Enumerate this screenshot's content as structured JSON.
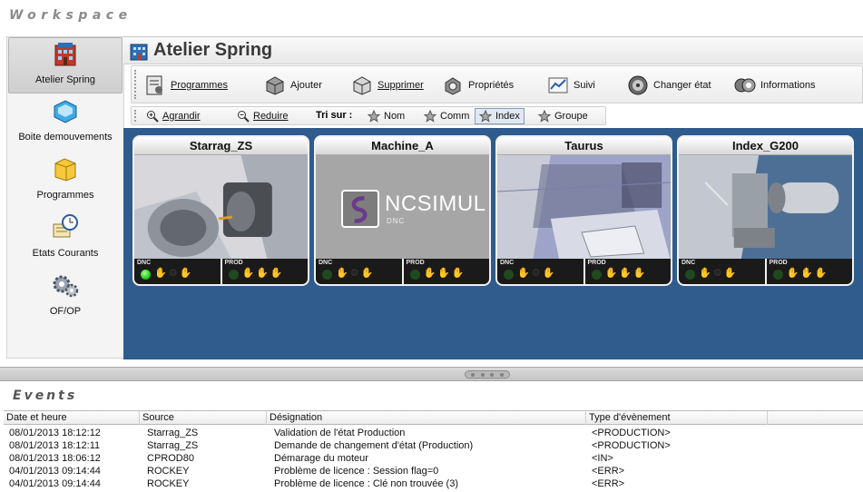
{
  "workspace_title": "Workspace",
  "sidebar": {
    "items": [
      {
        "label": "Atelier Spring",
        "icon": "building-icon",
        "active": true
      },
      {
        "label": "Boite demouvements",
        "icon": "tray-icon",
        "active": false
      },
      {
        "label": "Programmes",
        "icon": "folder-icon",
        "active": false
      },
      {
        "label": "Etats Courants",
        "icon": "clock-icon",
        "active": false
      },
      {
        "label": "OF/OP",
        "icon": "gears-icon",
        "active": false
      }
    ]
  },
  "main": {
    "title": "Atelier Spring",
    "toolbar": [
      {
        "label": "Programmes",
        "icon": "programs-icon",
        "underline": true
      },
      {
        "label": "Ajouter",
        "icon": "add-icon",
        "underline": false
      },
      {
        "label": "Supprimer",
        "icon": "delete-icon",
        "underline": true
      },
      {
        "label": "Propriétés",
        "icon": "properties-icon",
        "underline": false
      },
      {
        "label": "Suivi",
        "icon": "chart-icon",
        "underline": false
      },
      {
        "label": "Changer état",
        "icon": "change-state-icon",
        "underline": false
      },
      {
        "label": "Informations",
        "icon": "info-icon",
        "underline": false
      }
    ],
    "toolbar2": {
      "agrandir": "Agrandir",
      "reduire": "Reduire",
      "tri_sur": "Tri sur :",
      "sort_options": [
        "Nom",
        "Comm",
        "Index",
        "Groupe"
      ],
      "selected_sort": "Index"
    },
    "machines": [
      {
        "name": "Starrag_ZS",
        "dnc_label": "DNC",
        "prod_label": "PROD",
        "dnc_active": true
      },
      {
        "name": "Machine_A",
        "dnc_label": "DNC",
        "prod_label": "PROD",
        "dnc_active": false,
        "logo_text": "NCSIMUL",
        "logo_sub": "DNC"
      },
      {
        "name": "Taurus",
        "dnc_label": "DNC",
        "prod_label": "PROD",
        "dnc_active": false
      },
      {
        "name": "Index_G200",
        "dnc_label": "DNC",
        "prod_label": "PROD",
        "dnc_active": false
      }
    ]
  },
  "events": {
    "title": "Events",
    "columns": [
      "Date et heure",
      "Source",
      "Désignation",
      "Type d'évènement"
    ],
    "rows": [
      [
        "08/01/2013 18:12:12",
        "Starrag_ZS",
        "Validation de l'état Production",
        "<PRODUCTION>"
      ],
      [
        "08/01/2013 18:12:11",
        "Starrag_ZS",
        "Demande de changement d'état (Production)",
        "<PRODUCTION>"
      ],
      [
        "08/01/2013 18:06:12",
        "CPROD80",
        "Démarage du moteur",
        "<IN>"
      ],
      [
        "04/01/2013 09:14:44",
        "ROCKEY",
        "Problème de licence : Session flag=0",
        "<ERR>"
      ],
      [
        "04/01/2013 09:14:44",
        "ROCKEY",
        "Problème de licence : Clé non trouvée (3)",
        "<ERR>"
      ]
    ]
  },
  "colors": {
    "machines_background": "#2f5c8c",
    "led_on": "#1fd11f"
  }
}
